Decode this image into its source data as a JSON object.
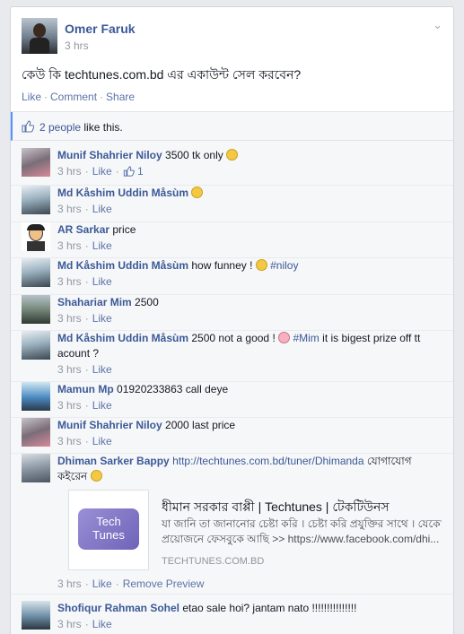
{
  "post": {
    "author": "Omer Faruk",
    "time": "3 hrs",
    "text": "কেউ কি techtunes.com.bd এর একাউন্ট সেল করবেন?",
    "actions": {
      "like": "Like",
      "comment": "Comment",
      "share": "Share"
    },
    "likes_count_text": "2 people",
    "likes_suffix": "like this."
  },
  "comments": [
    {
      "name": "Munif Shahrier Niloy",
      "text": "3500 tk only",
      "time": "3 hrs",
      "like": "Like",
      "like_count": "1"
    },
    {
      "name": "Md Kåshim Uddin Måsùm",
      "text": "",
      "time": "3 hrs",
      "like": "Like"
    },
    {
      "name": "AR Sarkar",
      "text": "price",
      "time": "3 hrs",
      "like": "Like"
    },
    {
      "name": "Md Kåshim Uddin Måsùm",
      "text": "how funney !",
      "tag": "#niloy",
      "time": "3 hrs",
      "like": "Like"
    },
    {
      "name": "Shahariar Mim",
      "text": "2500",
      "time": "3 hrs",
      "like": "Like"
    },
    {
      "name": "Md Kåshim Uddin Måsùm",
      "text": "2500 not a good !",
      "tag": "#Mim",
      "text2": "it is bigest prize off tt",
      "text3": "acount ?",
      "time": "3 hrs",
      "like": "Like"
    },
    {
      "name": "Mamun Mp",
      "text": "01920233863 call deye",
      "time": "3 hrs",
      "like": "Like"
    },
    {
      "name": "Munif Shahrier Niloy",
      "text": "2000 last price",
      "time": "3 hrs",
      "like": "Like"
    },
    {
      "name": "Dhiman Sarker Bappy",
      "link": "http://techtunes.com.bd/tuner/Dhimanda",
      "text": "যোগাযোগ",
      "text2": "কইরেন",
      "time": "3 hrs",
      "like": "Like",
      "remove_preview": "Remove Preview",
      "preview": {
        "title": "ধীমান সরকার বাপ্পী | Techtunes | টেকটিউনস",
        "desc1": "যা জানি তা জানানোর চেষ্টা করি । চেষ্টা করি প্রযুক্তির সাথে । যেকোনো",
        "desc2": "প্রয়োজনে ফেসবুকে আছি >> https://www.facebook.com/dhi...",
        "domain": "TECHTUNES.COM.BD",
        "logo_line1": "Tech",
        "logo_line2": "Tunes"
      }
    },
    {
      "name": "Shofiqur Rahman Sohel",
      "text": "etao sale hoi? jantam nato !!!!!!!!!!!!!!!",
      "time": "3 hrs",
      "like": "Like"
    }
  ],
  "colors": {
    "link": "#3b5998",
    "meta": "#9197a3",
    "accent": "#5890ff"
  }
}
